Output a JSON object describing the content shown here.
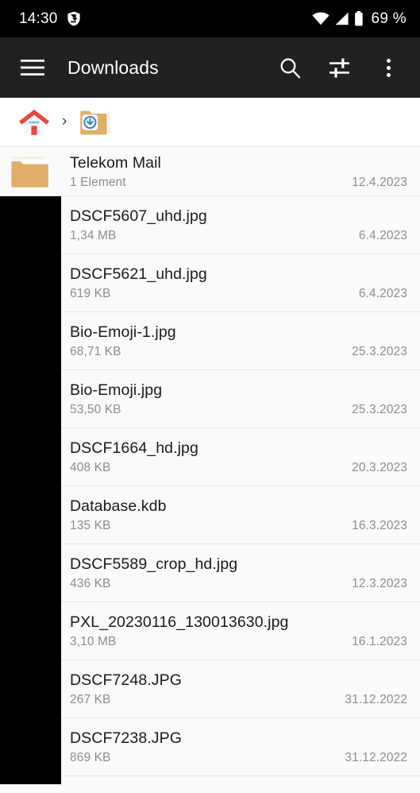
{
  "status_bar": {
    "time": "14:30",
    "left_icon": "shield-sync-icon",
    "icons": [
      "wifi-icon",
      "cell-signal-icon",
      "battery-icon"
    ],
    "battery_percent": "69 %",
    "background": "#000000",
    "foreground": "#ffffff"
  },
  "toolbar": {
    "menu_icon": "hamburger-menu-icon",
    "title": "Downloads",
    "search_icon": "search-icon",
    "filter_icon": "tune-sliders-icon",
    "overflow_icon": "more-vertical-icon",
    "background": "#212121",
    "foreground": "#ffffff"
  },
  "breadcrumb": {
    "items": [
      {
        "icon": "home-icon",
        "label": ""
      },
      {
        "icon": "downloads-folder-icon",
        "label": ""
      }
    ],
    "separator": "›"
  },
  "list": {
    "rows": [
      {
        "name": "Telekom Mail",
        "size": "1 Element",
        "date": "12.4.2023",
        "icon": "folder-icon",
        "type": "folder"
      },
      {
        "name": "DSCF5607_uhd.jpg",
        "size": "1,34 MB",
        "date": "6.4.2023",
        "icon": "image-thumbnail",
        "type": "file"
      },
      {
        "name": "DSCF5621_uhd.jpg",
        "size": "619 KB",
        "date": "6.4.2023",
        "icon": "image-thumbnail",
        "type": "file"
      },
      {
        "name": "Bio-Emoji-1.jpg",
        "size": "68,71 KB",
        "date": "25.3.2023",
        "icon": "image-thumbnail",
        "type": "file"
      },
      {
        "name": "Bio-Emoji.jpg",
        "size": "53,50 KB",
        "date": "25.3.2023",
        "icon": "image-thumbnail",
        "type": "file"
      },
      {
        "name": "DSCF1664_hd.jpg",
        "size": "408 KB",
        "date": "20.3.2023",
        "icon": "image-thumbnail",
        "type": "file"
      },
      {
        "name": "Database.kdb",
        "size": "135 KB",
        "date": "16.3.2023",
        "icon": "file-icon",
        "type": "file"
      },
      {
        "name": "DSCF5589_crop_hd.jpg",
        "size": "436 KB",
        "date": "12.3.2023",
        "icon": "image-thumbnail",
        "type": "file"
      },
      {
        "name": "PXL_20230116_130013630.jpg",
        "size": "3,10 MB",
        "date": "16.1.2023",
        "icon": "image-thumbnail",
        "type": "file"
      },
      {
        "name": "DSCF7248.JPG",
        "size": "267 KB",
        "date": "31.12.2022",
        "icon": "image-thumbnail",
        "type": "file"
      },
      {
        "name": "DSCF7238.JPG",
        "size": "869 KB",
        "date": "31.12.2022",
        "icon": "image-thumbnail",
        "type": "file"
      }
    ]
  },
  "colors": {
    "folder_fill": "#dfae68",
    "folder_flap": "#f6efe3",
    "home_roof": "#e8483f",
    "home_door": "#e8483f",
    "download_badge": "#2b7fc4",
    "list_background": "#fafafa",
    "divider": "#e6e6e6",
    "occlusion": "#000000"
  }
}
